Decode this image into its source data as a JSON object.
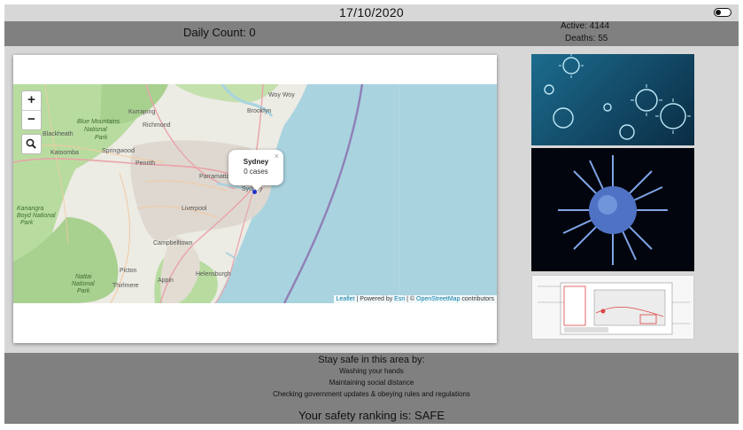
{
  "header": {
    "date": "17/10/2020",
    "theme_toggle_icon": "toggle-switch-icon"
  },
  "stats": {
    "daily_count": "Daily Count: 0",
    "active": "Active: 4144",
    "deaths": "Deaths: 55"
  },
  "map": {
    "zoom_in": "+",
    "zoom_out": "−",
    "search_icon": "magnifier-icon",
    "popup": {
      "title": "Sydney",
      "cases": "0 cases",
      "close": "×"
    },
    "place_labels": [
      "Woy Woy",
      "Kurrajong",
      "Brooklyn",
      "Blue Mountains",
      "National",
      "Park",
      "Richmond",
      "Blackheath",
      "Katoomba",
      "Springwood",
      "Penrith",
      "Parramatta",
      "Sydney",
      "Kanangra",
      "Boyd National",
      "Park",
      "Liverpool",
      "Campbelltown",
      "Picton",
      "Thirlmere",
      "Nattai",
      "National",
      "Park",
      "Appin",
      "Helensburgh"
    ],
    "attribution": {
      "leaflet": "Leaflet",
      "sep1": " | Powered by ",
      "esri": "Esri",
      "sep2": " | © ",
      "osm": "OpenStreetMap",
      "suffix": " contributors"
    },
    "colors": {
      "water": "#a9d3df",
      "land": "#ecebe4",
      "park": "#b8dca0",
      "urban": "#ded8d0",
      "road_major": "#e9a3a9",
      "road_minor": "#f3c9a0",
      "fault_line": "#8f7fb8",
      "marker": "#2233cc"
    }
  },
  "images": [
    {
      "name": "coronavirus-blue-particles-image"
    },
    {
      "name": "coronavirus-spike-image"
    },
    {
      "name": "app-layout-diagram-image"
    }
  ],
  "footer": {
    "title": "Stay safe in this area by:",
    "tips": [
      "Washing your hands",
      "Maintaining social distance",
      "Checking government updates & obeying rules and regulations"
    ],
    "ranking": "Your safety ranking is: SAFE"
  }
}
